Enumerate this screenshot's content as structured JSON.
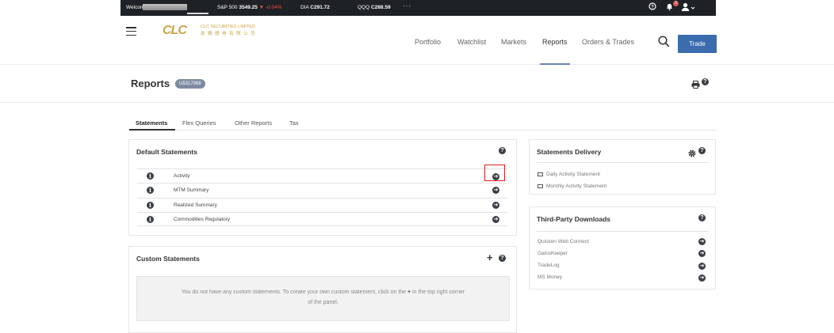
{
  "ticker": {
    "welcome": "Welcome",
    "quotes": [
      {
        "symbol": "S&P 500",
        "price": "3549.25",
        "change": "▼ -0.04%"
      },
      {
        "symbol": "DIA",
        "price": "C291.72",
        "change": ""
      },
      {
        "symbol": "QQQ",
        "price": "C288.59",
        "change": ""
      }
    ],
    "more": "···",
    "notification_count": "3"
  },
  "nav": {
    "logo_mark": "CLC",
    "logo_en": "CLC SECURITIES LIMITED",
    "logo_cn": "創 僑 證 券 有 限 公 司",
    "links": [
      "Portfolio",
      "Watchlist",
      "Markets",
      "Reports",
      "Orders & Trades"
    ],
    "active": "Reports",
    "trade_label": "Trade"
  },
  "header": {
    "title": "Reports",
    "account": "U5317968"
  },
  "tabs": [
    "Statements",
    "Flex Queries",
    "Other Reports",
    "Tax"
  ],
  "default_statements": {
    "title": "Default Statements",
    "items": [
      "Activity",
      "MTM Summary",
      "Realized Summary",
      "Commodities Regulatory"
    ]
  },
  "custom_statements": {
    "title": "Custom Statements",
    "empty_text_1": "You do not have any custom statements. To create your own custom statement, click on the",
    "empty_text_2": "in the top right corner",
    "empty_text_3": "of the panel."
  },
  "statements_delivery": {
    "title": "Statements Delivery",
    "items": [
      "Daily Activity Statement",
      "Monthly Activity Statement"
    ]
  },
  "third_party": {
    "title": "Third-Party Downloads",
    "items": [
      "Quicken Web Connect",
      "GainsKeeper",
      "TradeLog",
      "MS Money"
    ]
  },
  "colors": {
    "ticker_bg": "#1e2125",
    "trade_button": "#3b6cae",
    "logo_gold": "#c9a544",
    "highlight": "#e02020"
  }
}
